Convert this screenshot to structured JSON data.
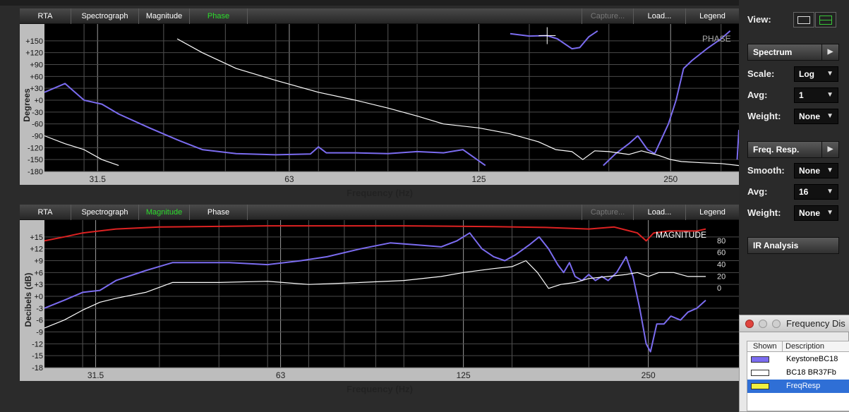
{
  "top_panel": {
    "tabs": [
      "RTA",
      "Spectrograph",
      "Magnitude",
      "Phase"
    ],
    "active_tab": "Phase",
    "capture_label": "Capture...",
    "load_label": "Load...",
    "legend_label": "Legend",
    "ylabel": "Degrees",
    "xlabel": "Frequency (Hz)",
    "overlay_label": "PHASE"
  },
  "bottom_panel": {
    "tabs": [
      "RTA",
      "Spectrograph",
      "Magnitude",
      "Phase"
    ],
    "active_tab": "Magnitude",
    "capture_label": "Capture...",
    "load_label": "Load...",
    "legend_label": "Legend",
    "ylabel": "Decibels (dB)",
    "xlabel": "Frequency (Hz)",
    "overlay_label": "MAGNITUDE"
  },
  "sidebar": {
    "view_label": "View:",
    "spectrum_button": "Spectrum",
    "scale_label": "Scale:",
    "scale_value": "Log",
    "avg_label": "Avg:",
    "avg_value": "1",
    "weight_label": "Weight:",
    "weight_value": "None",
    "freqresp_button": "Freq. Resp.",
    "smooth_label": "Smooth:",
    "smooth_value": "None",
    "avg2_label": "Avg:",
    "avg2_value": "16",
    "weight2_label": "Weight:",
    "weight2_value": "None",
    "ir_button": "IR Analysis"
  },
  "freq_window": {
    "title": "Frequency Dis",
    "col_shown": "Shown",
    "col_description": "Description",
    "rows": [
      {
        "description": "KeystoneBC18",
        "color": "#7b6cf0"
      },
      {
        "description": "BC18 BR37Fb",
        "color": "#ffffff"
      },
      {
        "description": "FreqResp",
        "color": "#f0f040",
        "selected": true
      }
    ]
  },
  "chart_data": [
    {
      "type": "line",
      "title": "PHASE",
      "xlabel": "Frequency (Hz)",
      "ylabel": "Degrees",
      "x_scale": "log",
      "xlim": [
        26,
        320
      ],
      "ylim": [
        -180,
        180
      ],
      "x_ticks": [
        31.5,
        63,
        125,
        250
      ],
      "y_ticks": [
        "+150",
        "+120",
        "+90",
        "+60",
        "+30",
        "+0",
        "-30",
        "-60",
        "-90",
        "-120",
        "-150",
        "-180"
      ],
      "series": [
        {
          "name": "KeystoneBC18",
          "color": "#7b6cf0",
          "segments": [
            [
              [
                26,
                20
              ],
              [
                28,
                42
              ],
              [
                30,
                0
              ],
              [
                32,
                -10
              ],
              [
                34,
                -35
              ],
              [
                38,
                -70
              ],
              [
                42,
                -100
              ],
              [
                46,
                -125
              ],
              [
                52,
                -135
              ],
              [
                60,
                -138
              ],
              [
                68,
                -136
              ],
              [
                70,
                -118
              ],
              [
                72,
                -133
              ],
              [
                80,
                -133
              ],
              [
                90,
                -135
              ],
              [
                100,
                -130
              ],
              [
                110,
                -133
              ],
              [
                118,
                -125
              ],
              [
                128,
                -165
              ]
            ],
            [
              [
                140,
                168
              ],
              [
                150,
                162
              ],
              [
                160,
                163
              ],
              [
                166,
                155
              ],
              [
                175,
                130
              ],
              [
                180,
                133
              ],
              [
                186,
                160
              ],
              [
                192,
                175
              ]
            ],
            [
              [
                196,
                -165
              ],
              [
                205,
                -135
              ],
              [
                215,
                -110
              ],
              [
                222,
                -90
              ],
              [
                230,
                -125
              ],
              [
                236,
                -135
              ],
              [
                240,
                -110
              ],
              [
                248,
                -60
              ],
              [
                255,
                0
              ],
              [
                262,
                80
              ],
              [
                270,
                100
              ],
              [
                285,
                130
              ],
              [
                300,
                155
              ],
              [
                310,
                175
              ]
            ],
            [
              [
                318,
                -150
              ],
              [
                320,
                -75
              ]
            ]
          ]
        },
        {
          "name": "BC18 BR37Fb",
          "color": "#ffffff",
          "segments": [
            [
              [
                26,
                -90
              ],
              [
                28,
                -110
              ],
              [
                30,
                -125
              ],
              [
                32,
                -150
              ],
              [
                34,
                -165
              ]
            ],
            [
              [
                42,
                155
              ],
              [
                46,
                120
              ],
              [
                52,
                80
              ],
              [
                60,
                50
              ],
              [
                70,
                20
              ],
              [
                80,
                0
              ],
              [
                90,
                -20
              ],
              [
                100,
                -40
              ],
              [
                110,
                -60
              ],
              [
                125,
                -70
              ],
              [
                140,
                -85
              ],
              [
                155,
                -105
              ],
              [
                165,
                -125
              ],
              [
                175,
                -130
              ],
              [
                182,
                -150
              ],
              [
                190,
                -128
              ],
              [
                200,
                -130
              ],
              [
                215,
                -137
              ],
              [
                225,
                -128
              ],
              [
                240,
                -140
              ],
              [
                250,
                -150
              ],
              [
                260,
                -155
              ],
              [
                280,
                -158
              ],
              [
                300,
                -160
              ],
              [
                320,
                -165
              ]
            ]
          ]
        }
      ]
    },
    {
      "type": "line",
      "title": "MAGNITUDE",
      "xlabel": "Frequency (Hz)",
      "ylabel": "Decibels (dB)",
      "x_scale": "log",
      "xlim": [
        26,
        320
      ],
      "ylim": [
        -18,
        18
      ],
      "x_ticks": [
        31.5,
        63,
        125,
        250
      ],
      "y_ticks": [
        "+15",
        "+12",
        "+9",
        "+6",
        "+3",
        "+0",
        "-3",
        "-6",
        "-9",
        "-12",
        "-15",
        "-18"
      ],
      "right_ticks": [
        "80",
        "60",
        "40",
        "20",
        "0"
      ],
      "series": [
        {
          "name": "KeystoneBC18",
          "color": "#7b6cf0",
          "points": [
            [
              26,
              -3
            ],
            [
              28,
              -1
            ],
            [
              30,
              1
            ],
            [
              32,
              1.5
            ],
            [
              34,
              4
            ],
            [
              38,
              6.5
            ],
            [
              42,
              8.5
            ],
            [
              46,
              8.5
            ],
            [
              52,
              8.5
            ],
            [
              60,
              8
            ],
            [
              68,
              9
            ],
            [
              75,
              10
            ],
            [
              85,
              12
            ],
            [
              95,
              13.5
            ],
            [
              105,
              13
            ],
            [
              115,
              12.5
            ],
            [
              122,
              14
            ],
            [
              128,
              16
            ],
            [
              134,
              12
            ],
            [
              140,
              10
            ],
            [
              146,
              9
            ],
            [
              152,
              10.5
            ],
            [
              160,
              13
            ],
            [
              166,
              15
            ],
            [
              172,
              12
            ],
            [
              178,
              8
            ],
            [
              182,
              6
            ],
            [
              186,
              8.5
            ],
            [
              190,
              5
            ],
            [
              195,
              4
            ],
            [
              200,
              5.5
            ],
            [
              205,
              4
            ],
            [
              210,
              5
            ],
            [
              215,
              4
            ],
            [
              222,
              6
            ],
            [
              230,
              10
            ],
            [
              236,
              5
            ],
            [
              242,
              -3
            ],
            [
              248,
              -12
            ],
            [
              252,
              -14
            ],
            [
              258,
              -7
            ],
            [
              265,
              -7
            ],
            [
              272,
              -5
            ],
            [
              282,
              -6
            ],
            [
              290,
              -4
            ],
            [
              300,
              -3
            ],
            [
              310,
              -1
            ]
          ]
        },
        {
          "name": "BC18 BR37Fb",
          "color": "#ffffff",
          "points": [
            [
              26,
              -8
            ],
            [
              28,
              -6
            ],
            [
              30,
              -3.5
            ],
            [
              32,
              -1.5
            ],
            [
              34,
              -0.5
            ],
            [
              38,
              1
            ],
            [
              42,
              3.5
            ],
            [
              50,
              3.5
            ],
            [
              60,
              3.8
            ],
            [
              70,
              3
            ],
            [
              85,
              3.5
            ],
            [
              100,
              4
            ],
            [
              115,
              5
            ],
            [
              125,
              6
            ],
            [
              140,
              7
            ],
            [
              150,
              7.5
            ],
            [
              158,
              9
            ],
            [
              165,
              6
            ],
            [
              172,
              2
            ],
            [
              180,
              3
            ],
            [
              190,
              3.5
            ],
            [
              200,
              4.5
            ],
            [
              215,
              5
            ],
            [
              230,
              5.5
            ],
            [
              240,
              6
            ],
            [
              250,
              5
            ],
            [
              260,
              6
            ],
            [
              275,
              6
            ],
            [
              290,
              5
            ],
            [
              310,
              5
            ]
          ]
        },
        {
          "name": "FreqResp",
          "color": "#dd2222",
          "points": [
            [
              26,
              14
            ],
            [
              28,
              15
            ],
            [
              30,
              16
            ],
            [
              34,
              17
            ],
            [
              40,
              17.5
            ],
            [
              60,
              17.8
            ],
            [
              100,
              17.8
            ],
            [
              140,
              17.6
            ],
            [
              170,
              17.4
            ],
            [
              200,
              17
            ],
            [
              220,
              17.5
            ],
            [
              240,
              16
            ],
            [
              248,
              14
            ],
            [
              255,
              16
            ],
            [
              270,
              16.5
            ],
            [
              300,
              16.5
            ],
            [
              310,
              17
            ]
          ]
        }
      ]
    }
  ]
}
